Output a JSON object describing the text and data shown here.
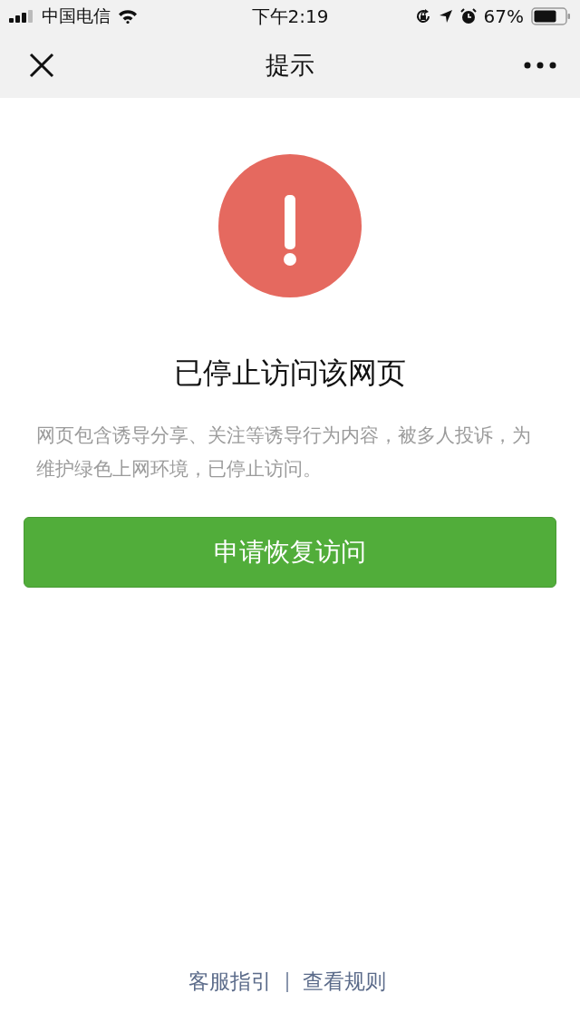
{
  "status_bar": {
    "carrier": "中国电信",
    "time": "下午2:19",
    "battery_percent": "67%"
  },
  "nav_bar": {
    "title": "提示"
  },
  "notice": {
    "title": "已停止访问该网页",
    "message": "网页包含诱导分享、关注等诱导行为内容，被多人投诉，为维护绿色上网环境，已停止访问。"
  },
  "primary_button": {
    "label": "申请恢复访问"
  },
  "footer_links": [
    {
      "label": "客服指引"
    },
    {
      "label": "查看规则"
    }
  ]
}
